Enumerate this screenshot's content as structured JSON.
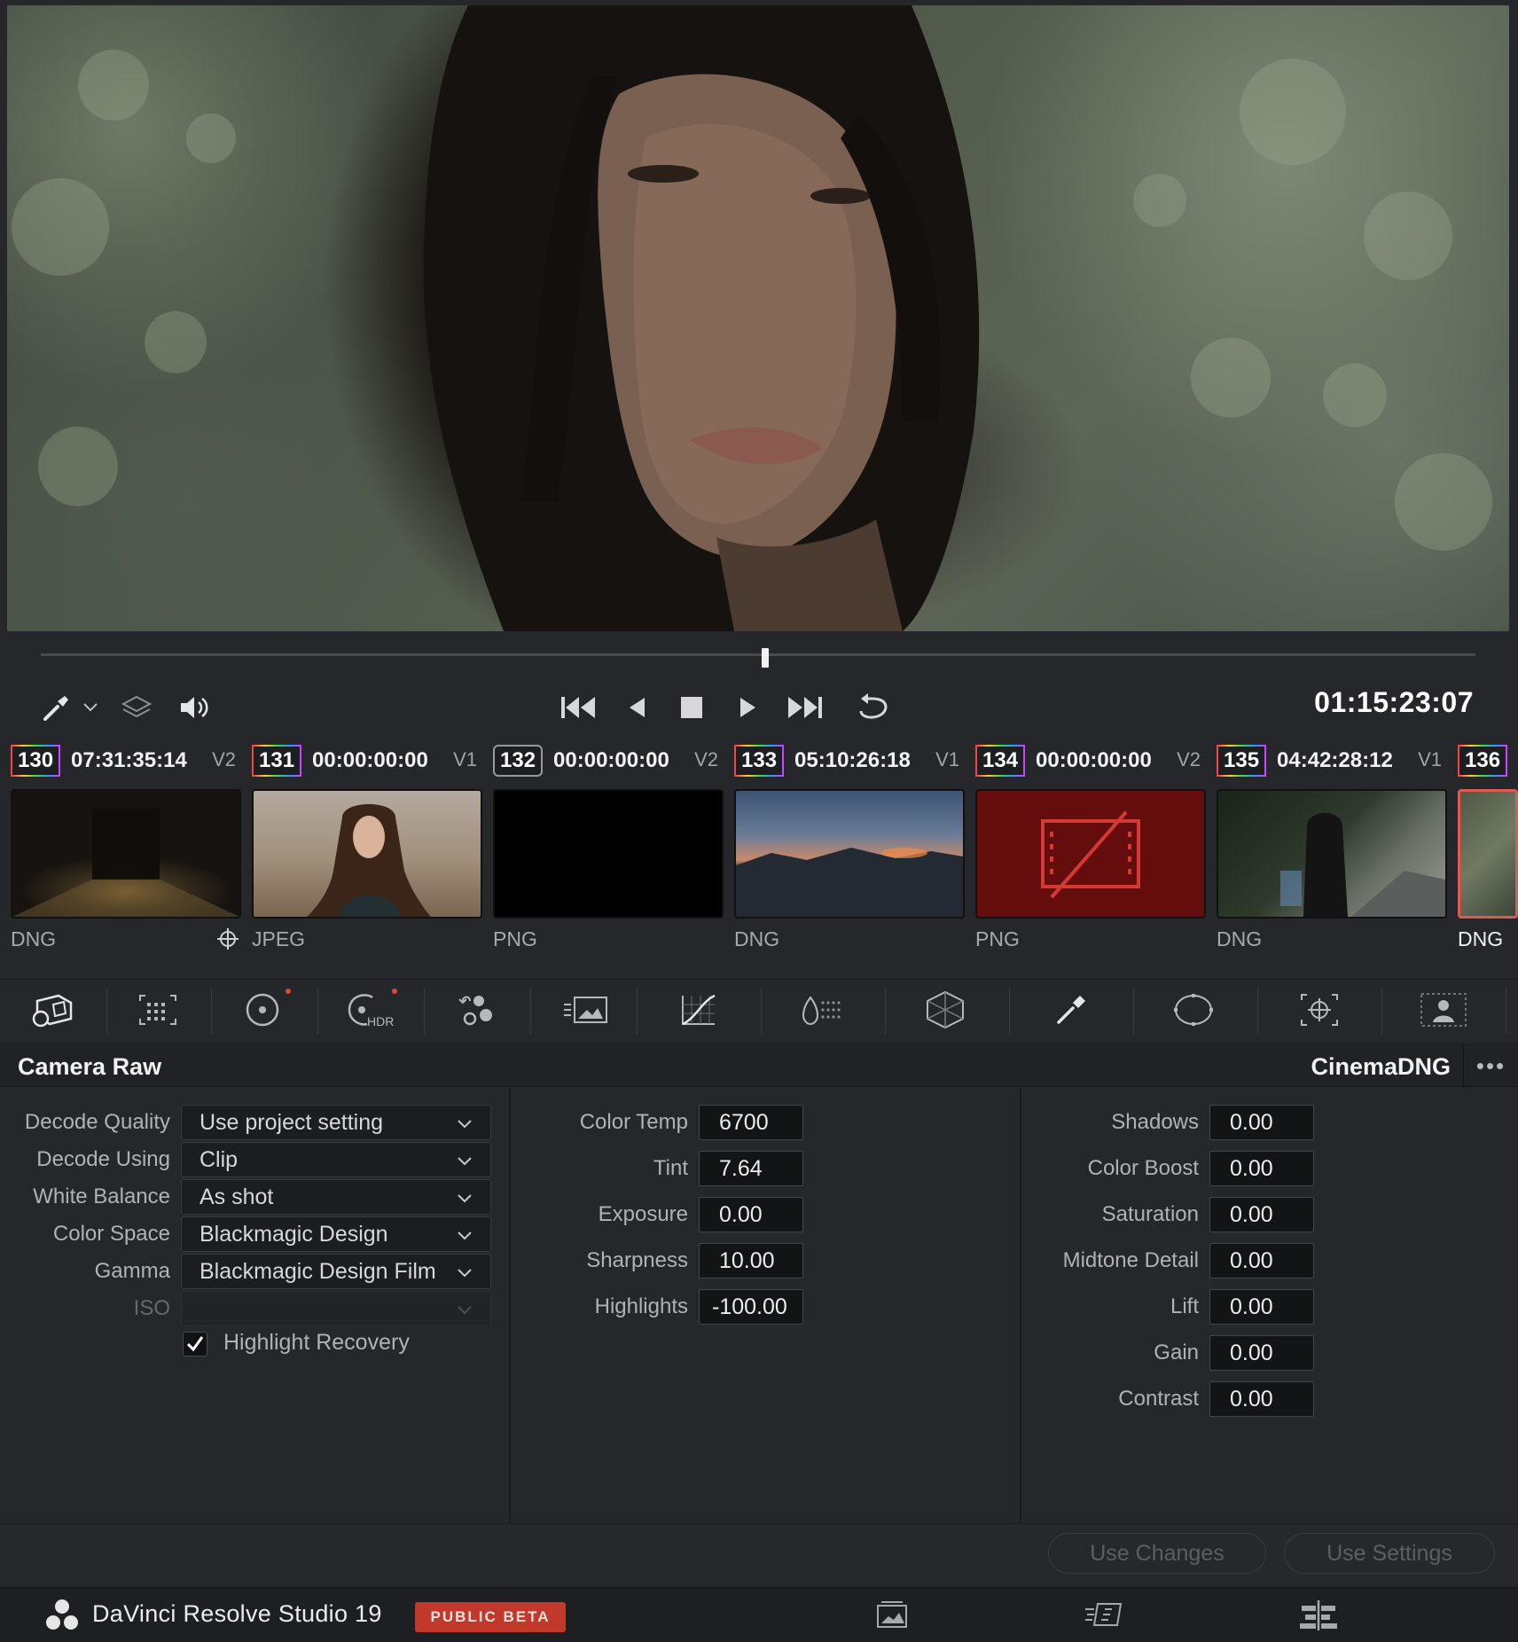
{
  "viewer": {
    "timecode": "01:15:23:07",
    "playhead_position": 0.505
  },
  "clips": [
    {
      "number": "130",
      "timecode": "07:31:35:14",
      "track": "V2",
      "type": "DNG"
    },
    {
      "number": "131",
      "timecode": "00:00:00:00",
      "track": "V1",
      "type": "JPEG"
    },
    {
      "number": "132",
      "timecode": "00:00:00:00",
      "track": "V2",
      "type": "PNG"
    },
    {
      "number": "133",
      "timecode": "05:10:26:18",
      "track": "V1",
      "type": "DNG"
    },
    {
      "number": "134",
      "timecode": "00:00:00:00",
      "track": "V2",
      "type": "PNG"
    },
    {
      "number": "135",
      "timecode": "04:42:28:12",
      "track": "V1",
      "type": "DNG"
    },
    {
      "number": "136",
      "timecode": "",
      "track": "",
      "type": "DNG"
    }
  ],
  "panel": {
    "title": "Camera Raw",
    "format": "CinemaDNG",
    "more": "•••",
    "left": {
      "decode_quality": {
        "label": "Decode Quality",
        "value": "Use project setting"
      },
      "decode_using": {
        "label": "Decode Using",
        "value": "Clip"
      },
      "white_balance": {
        "label": "White Balance",
        "value": "As shot"
      },
      "color_space": {
        "label": "Color Space",
        "value": "Blackmagic Design"
      },
      "gamma": {
        "label": "Gamma",
        "value": "Blackmagic Design Film"
      },
      "iso": {
        "label": "ISO",
        "value": ""
      },
      "highlight_recovery": {
        "label": "Highlight Recovery",
        "checked": true
      }
    },
    "middle": {
      "color_temp": {
        "label": "Color Temp",
        "value": "6700"
      },
      "tint": {
        "label": "Tint",
        "value": "7.64"
      },
      "exposure": {
        "label": "Exposure",
        "value": "0.00"
      },
      "sharpness": {
        "label": "Sharpness",
        "value": "10.00"
      },
      "highlights": {
        "label": "Highlights",
        "value": "-100.00"
      }
    },
    "right": {
      "shadows": {
        "label": "Shadows",
        "value": "0.00"
      },
      "color_boost": {
        "label": "Color Boost",
        "value": "0.00"
      },
      "saturation": {
        "label": "Saturation",
        "value": "0.00"
      },
      "midtone_detail": {
        "label": "Midtone Detail",
        "value": "0.00"
      },
      "lift": {
        "label": "Lift",
        "value": "0.00"
      },
      "gain": {
        "label": "Gain",
        "value": "0.00"
      },
      "contrast": {
        "label": "Contrast",
        "value": "0.00"
      }
    }
  },
  "actions": {
    "use_changes": "Use Changes",
    "use_settings": "Use Settings"
  },
  "appbar": {
    "name": "DaVinci Resolve Studio 19",
    "badge": "PUBLIC BETA"
  },
  "colors": {
    "accent_red": "#c0392b",
    "panel_bg": "#26272b",
    "selected_clip_border": "#e05a50"
  }
}
